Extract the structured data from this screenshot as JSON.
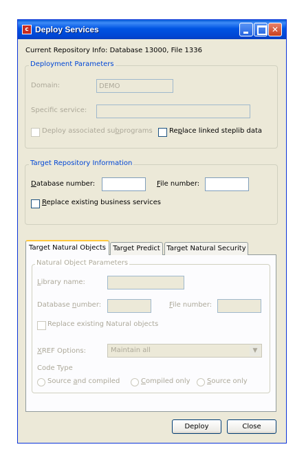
{
  "window": {
    "title": "Deploy Services"
  },
  "repo_info": "Current Repository Info: Database 13000, File 1336",
  "deployment_params": {
    "legend": "Deployment Parameters",
    "domain_label": "Domain:",
    "domain_value": "DEMO",
    "specific_service_label": "Specific service:",
    "specific_service_value": "",
    "deploy_subprograms": {
      "pre": "Deploy associated su",
      "key": "b",
      "post": "programs"
    },
    "replace_steplib": {
      "pre": "Re",
      "key": "p",
      "post": "lace linked steplib data"
    }
  },
  "target_repo": {
    "legend": "Target Repository Information",
    "db_number_label": {
      "pre": "",
      "key": "D",
      "post": "atabase number:"
    },
    "db_number_value": "",
    "file_number_label": {
      "pre": "",
      "key": "F",
      "post": "ile number:"
    },
    "file_number_value": "",
    "replace_business": {
      "pre": "",
      "key": "R",
      "post": "eplace existing business services"
    }
  },
  "tabs": [
    "Target Natural Objects",
    "Target Predict",
    "Target Natural Security"
  ],
  "natural_params": {
    "legend": "Natural Object Parameters",
    "library_label": {
      "pre": "",
      "key": "L",
      "post": "ibrary name:"
    },
    "library_value": "",
    "db_number_label": {
      "pre": "Database ",
      "key": "n",
      "post": "umber:"
    },
    "db_number_value": "",
    "file_number_label": {
      "pre": "",
      "key": "F",
      "post": "ile number:"
    },
    "file_number_value": "",
    "replace_natural": "Replace existing Natural objects",
    "xref_label": {
      "pre": "",
      "key": "X",
      "post": "REF Options:"
    },
    "xref_value": "Maintain all",
    "code_type_label": "Code Type",
    "radio_source_compiled": {
      "pre": "Source ",
      "key": "a",
      "post": "nd compiled"
    },
    "radio_compiled_only": {
      "pre": "",
      "key": "C",
      "post": "ompiled only"
    },
    "radio_source_only": {
      "pre": "",
      "key": "S",
      "post": "ource only"
    }
  },
  "buttons": {
    "deploy": "Deploy",
    "close": "Close"
  }
}
